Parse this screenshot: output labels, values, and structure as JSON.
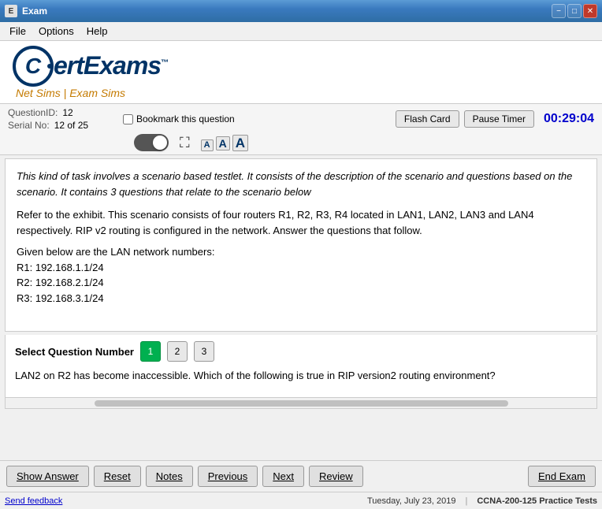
{
  "titleBar": {
    "icon": "E",
    "title": "Exam",
    "minimizeLabel": "−",
    "maximizeLabel": "□",
    "closeLabel": "✕"
  },
  "menuBar": {
    "items": [
      "File",
      "Options",
      "Help"
    ]
  },
  "logo": {
    "letter": "C",
    "brandName": "CertExams",
    "tm": "™",
    "subtitle": "Net Sims | Exam Sims"
  },
  "toolbar": {
    "questionIdLabel": "QuestionID:",
    "questionIdValue": "12",
    "serialNoLabel": "Serial No:",
    "serialNoValue": "12 of 25",
    "bookmarkLabel": "Bookmark this question",
    "flashCardLabel": "Flash Card",
    "pauseTimerLabel": "Pause Timer",
    "timerValue": "00:29:04",
    "fontSmall": "A",
    "fontMedium": "A",
    "fontLarge": "A"
  },
  "content": {
    "scenarioText": "This kind of task involves a scenario based testlet. It consists of the description of the scenario and questions based on the scenario. It contains 3 questions that relate to the scenario below",
    "questionText1": "Refer to the exhibit. This scenario consists of four routers R1, R2, R3, R4 located in LAN1, LAN2, LAN3 and LAN4 respectively. RIP v2 routing is configured in the network. Answer the questions that follow.",
    "networkInfo": "Given below are the LAN network numbers:",
    "r1": "R1: 192.168.1.1/24",
    "r2": "R2: 192.168.2.1/24",
    "r3": "R3: 192.168.3.1/24"
  },
  "selectQuestion": {
    "label": "Select Question Number",
    "numbers": [
      "1",
      "2",
      "3"
    ],
    "activeNumber": "1",
    "questionBody": "LAN2 on R2 has become inaccessible. Which of the following is true in RIP version2 routing environment?"
  },
  "bottomButtons": {
    "showAnswer": "Show Answer",
    "reset": "Reset",
    "notes": "Notes",
    "previous": "Previous",
    "next": "Next",
    "review": "Review",
    "endExam": "End Exam"
  },
  "statusBar": {
    "sendFeedback": "Send feedback",
    "date": "Tuesday, July 23, 2019",
    "examName": "CCNA-200-125 Practice Tests"
  }
}
